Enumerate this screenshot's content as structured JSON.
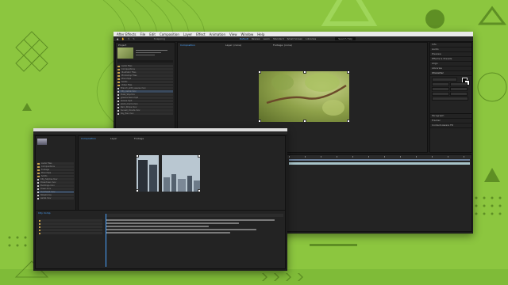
{
  "background": {
    "color": "#8cc63f",
    "pattern_color": "#6ea52c"
  },
  "window_back": {
    "menu": [
      "After Effects",
      "File",
      "Edit",
      "Composition",
      "Layer",
      "Effect",
      "Animation",
      "View",
      "Window",
      "Help"
    ],
    "toolbar_mode": "Snapping",
    "workspaces": [
      "Default",
      "Review",
      "Learn",
      "Standard",
      "Small Screen",
      "Libraries"
    ],
    "search_label": "Search Help",
    "project_tab": "Project",
    "comp_tab": "Composition",
    "layer_tab": "Layer: (none)",
    "footage_tab": "Footage: (none)",
    "project_items": [
      "Audio Files",
      "Compositions",
      "Illustrator Files",
      "Photoshop Files",
      "Precomps",
      "Solids",
      "Video Files",
      "Branch_with_Leaves.mov",
      "City_Aerial.mov",
      "Dusk_Sky.mov",
      "greenscreen.mp4",
      "leaves.mp4",
      "plant_macro.mov",
      "Rain_Drops.mov",
      "Sunset_Clouds.mov",
      "Sky_Pan.mov"
    ],
    "selected_item_index": 8,
    "right_panels": [
      "Info",
      "Audio",
      "Preview",
      "Effects & Presets",
      "Align",
      "Libraries",
      "Character"
    ],
    "bottom_right_panels": [
      "Paragraph",
      "Tracker",
      "Content-Aware Fill"
    ]
  },
  "window_front": {
    "comp_tabs": [
      "Composition",
      "Layer",
      "Footage"
    ],
    "project_items": [
      "Audio Files",
      "Compositions",
      "Footage",
      "Precomps",
      "Solids",
      "City_Skyline.mov",
      "Downtown.mov",
      "Buildings.mov",
      "Tower.mov",
      "Overhead.mov",
      "Street.mov",
      "Aerial.mov"
    ],
    "selected_item_index": 9,
    "timeline_tab": "City Comp",
    "layer_count": 5
  },
  "colors": {
    "accent": "#4aa3ff",
    "panel": "#232323",
    "window": "#1c1c1c"
  }
}
